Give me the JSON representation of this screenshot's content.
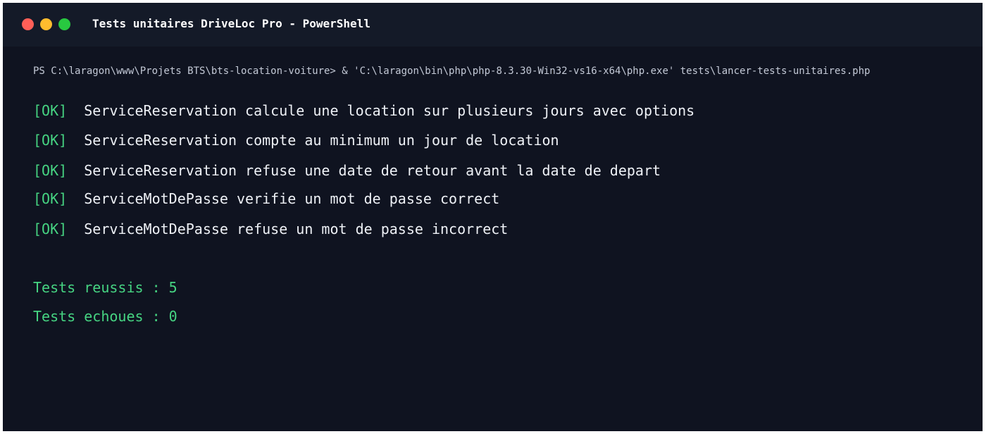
{
  "window": {
    "title": "Tests unitaires DriveLoc Pro - PowerShell",
    "traffic_lights": {
      "close_color": "#ff5f57",
      "minimize_color": "#febc2e",
      "maximize_color": "#28c840"
    }
  },
  "terminal": {
    "prompt_line": "PS C:\\laragon\\www\\Projets BTS\\bts-location-voiture> & 'C:\\laragon\\bin\\php\\php-8.3.30-Win32-vs16-x64\\php.exe' tests\\lancer-tests-unitaires.php",
    "results": [
      {
        "status": "[OK]",
        "message": "ServiceReservation calcule une location sur plusieurs jours avec options"
      },
      {
        "status": "[OK]",
        "message": "ServiceReservation compte au minimum un jour de location"
      },
      {
        "status": "[OK]",
        "message": "ServiceReservation refuse une date de retour avant la date de depart"
      },
      {
        "status": "[OK]",
        "message": "ServiceMotDePasse verifie un mot de passe correct"
      },
      {
        "status": "[OK]",
        "message": "ServiceMotDePasse refuse un mot de passe incorrect"
      }
    ],
    "summary": {
      "passed": "Tests reussis : 5",
      "failed": "Tests echoues : 0"
    }
  },
  "colors": {
    "background": "#0f1320",
    "titlebar": "#141a28",
    "ok_green": "#46d482",
    "summary_green": "#46d482",
    "text": "#eef1f6",
    "prompt_text": "#c3c9d6"
  }
}
